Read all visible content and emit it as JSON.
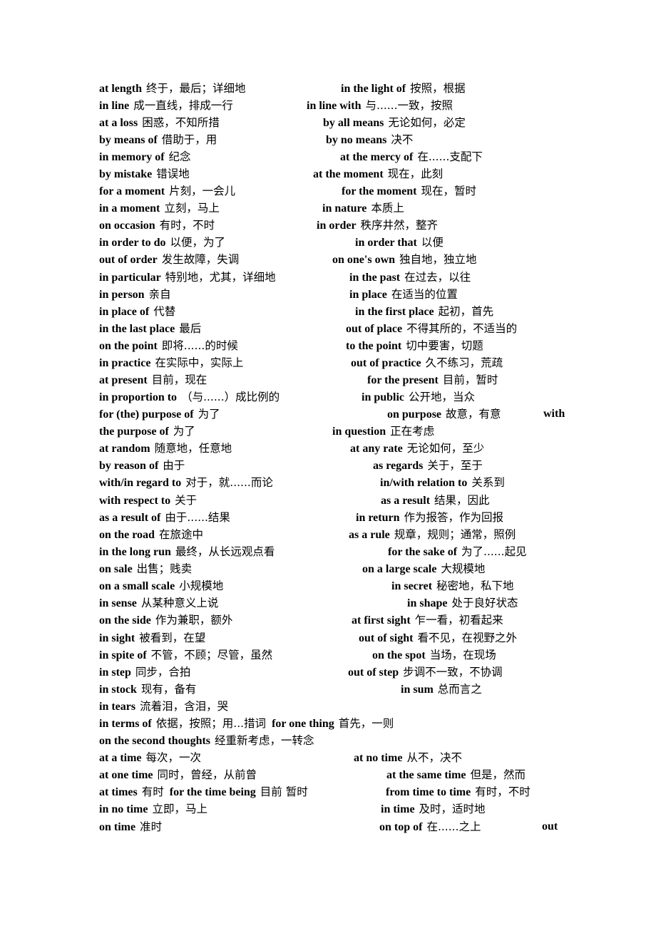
{
  "document": {
    "lines": [
      {
        "left": {
          "en": "at length",
          "zh": "终于，最后；详细地"
        },
        "right": {
          "en": "in the light of",
          "zh": "按照，根据"
        }
      },
      {
        "left": {
          "en": "in line",
          "zh": "成一直线，排成一行"
        },
        "right": {
          "en": "in line with",
          "zh": "与......一致，按照"
        }
      },
      {
        "left": {
          "en": "at a loss",
          "zh": "困惑，不知所措"
        },
        "right": {
          "en": "by all means",
          "zh": "无论如何，必定"
        }
      },
      {
        "left": {
          "en": "by means of",
          "zh": "借助于，用"
        },
        "right": {
          "en": "by no means",
          "zh": "决不"
        }
      },
      {
        "left": {
          "en": "in memory of",
          "zh": "纪念"
        },
        "right": {
          "en": "at the mercy of",
          "zh": "在......支配下"
        }
      },
      {
        "left": {
          "en": "by mistake",
          "zh": "错误地"
        },
        "right": {
          "en": "at the moment",
          "zh": "现在，此刻"
        }
      },
      {
        "left": {
          "en": "for a moment",
          "zh": "片刻，一会儿"
        },
        "right": {
          "en": "for the moment",
          "zh": "现在，暂时"
        }
      },
      {
        "left": {
          "en": "in a moment",
          "zh": "立刻，马上"
        },
        "right": {
          "en": "in nature",
          "zh": "本质上"
        }
      },
      {
        "left": {
          "en": "on occasion",
          "zh": "有时，不时"
        },
        "right": {
          "en": "in order",
          "zh": "秩序井然，整齐"
        }
      },
      {
        "left": {
          "en": "in order to do",
          "zh": "以便，为了"
        },
        "right": {
          "en": "in order that",
          "zh": "以便"
        }
      },
      {
        "left": {
          "en": "out of order",
          "zh": "发生故障，失调"
        },
        "right": {
          "en": "on one's own",
          "zh": "独自地，独立地"
        }
      },
      {
        "left": {
          "en": "in particular",
          "zh": "特别地，尤其，详细地"
        },
        "right": {
          "en": "in the past",
          "zh": "在过去，以往"
        }
      },
      {
        "left": {
          "en": "in person",
          "zh": "亲自"
        },
        "right": {
          "en": "in place",
          "zh": "在适当的位置"
        }
      },
      {
        "left": {
          "en": "in place of",
          "zh": "代替"
        },
        "right": {
          "en": "in the first place",
          "zh": "起初，首先"
        }
      },
      {
        "left": {
          "en": "in the last place",
          "zh": "最后"
        },
        "right": {
          "en": "out of place",
          "zh": "不得其所的，不适当的"
        }
      },
      {
        "left": {
          "en": "on the point",
          "zh": "即将......的时候"
        },
        "right": {
          "en": "to the point",
          "zh": "切中要害，切题"
        }
      },
      {
        "left": {
          "en": "in practice",
          "zh": "在实际中，实际上"
        },
        "right": {
          "en": "out of practice",
          "zh": "久不练习，荒疏"
        }
      },
      {
        "left": {
          "en": "at present",
          "zh": "目前，现在"
        },
        "right": {
          "en": "for the present",
          "zh": "目前，暂时"
        }
      },
      {
        "left": {
          "en": "in proportion to",
          "zh": "（与......）成比例的"
        },
        "right": {
          "en": "in public",
          "zh": "公开地，当众"
        }
      },
      {
        "left": {
          "en": "for (the) purpose of",
          "zh": "为了"
        },
        "right": {
          "en": "on purpose",
          "zh": "故意，有意"
        },
        "tail": "with"
      },
      {
        "left": {
          "en": "the purpose of",
          "zh": "为了"
        },
        "right": {
          "en": "in question",
          "zh": "正在考虑"
        }
      },
      {
        "left": {
          "en": "at random",
          "zh": "随意地，任意地"
        },
        "right": {
          "en": "at any rate",
          "zh": "无论如何，至少"
        }
      },
      {
        "left": {
          "en": "by reason of",
          "zh": "由于"
        },
        "right": {
          "en": "as regards",
          "zh": "关于，至于"
        }
      },
      {
        "left": {
          "en": "with/in regard to",
          "zh": "对于，就......而论"
        },
        "right": {
          "en": "in/with relation to",
          "zh": "关系到"
        }
      },
      {
        "left": {
          "en": "with respect to",
          "zh": "关于"
        },
        "right": {
          "en": "as a result",
          "zh": "结果，因此"
        }
      },
      {
        "left": {
          "en": "as a result of",
          "zh": "由于......结果"
        },
        "right": {
          "en": "in return",
          "zh": "作为报答，作为回报"
        }
      },
      {
        "left": {
          "en": "on the road",
          "zh": "在旅途中"
        },
        "right": {
          "en": "as a rule",
          "zh": "规章，规则；通常，照例"
        }
      },
      {
        "left": {
          "en": "in the long run",
          "zh": "最终，从长远观点看"
        },
        "right": {
          "en": "for the sake of",
          "zh": "为了......起见"
        }
      },
      {
        "left": {
          "en": "on sale",
          "zh": "出售；贱卖"
        },
        "right": {
          "en": "on a large scale",
          "zh": "大规模地"
        }
      },
      {
        "left": {
          "en": "on a small scale",
          "zh": "小规模地"
        },
        "right": {
          "en": "in secret",
          "zh": "秘密地，私下地"
        }
      },
      {
        "left": {
          "en": "in sense",
          "zh": "从某种意义上说"
        },
        "right": {
          "en": "in shape",
          "zh": "处于良好状态"
        }
      },
      {
        "left": {
          "en": "on the side",
          "zh": "作为兼职，额外"
        },
        "right": {
          "en": "at first sight",
          "zh": "乍一看，初看起来"
        }
      },
      {
        "left": {
          "en": "in sight",
          "zh": "被看到，在望"
        },
        "right": {
          "en": "out of sight",
          "zh": "看不见，在视野之外"
        }
      },
      {
        "left": {
          "en": "in spite of",
          "zh": "不管，不顾；尽管，虽然"
        },
        "right": {
          "en": "on the spot",
          "zh": "当场，在现场"
        }
      },
      {
        "left": {
          "en": "in step",
          "zh": "同步，合拍"
        },
        "right": {
          "en": "out of step",
          "zh": "步调不一致，不协调"
        }
      },
      {
        "left": {
          "en": "in stock",
          "zh": "现有，备有"
        },
        "right": {
          "en": "in sum",
          "zh": "总而言之"
        }
      },
      {
        "left": {
          "en": "in tears",
          "zh": "流着泪，含泪，哭"
        }
      },
      {
        "left": {
          "en": "in terms of",
          "zh": "依据，按照；用...措词"
        },
        "inline": {
          "en": "for one thing",
          "zh": "首先，一则"
        }
      },
      {
        "left": {
          "en": "on the second thoughts",
          "zh": "经重新考虑，一转念"
        }
      },
      {
        "left": {
          "en": "at a time",
          "zh": "每次，一次"
        },
        "right": {
          "en": "at no time",
          "zh": "从不，决不"
        }
      },
      {
        "left": {
          "en": "at one time",
          "zh": "同时，曾经，从前曾"
        },
        "right": {
          "en": "at the same time",
          "zh": "但是，然而"
        }
      },
      {
        "left": {
          "en": "at times",
          "zh": "有时"
        },
        "inline": {
          "en": "for the time being",
          "zh": "目前  暂时"
        },
        "right": {
          "en": "from time to time",
          "zh": "有时，不时"
        }
      },
      {
        "left": {
          "en": "in no time",
          "zh": "立即，马上"
        },
        "right": {
          "en": "in time",
          "zh": "及时，适时地"
        }
      },
      {
        "left": {
          "en": "on time",
          "zh": "准时"
        },
        "right": {
          "en": "on top of",
          "zh": "在......之上"
        },
        "tail": "out"
      }
    ]
  }
}
